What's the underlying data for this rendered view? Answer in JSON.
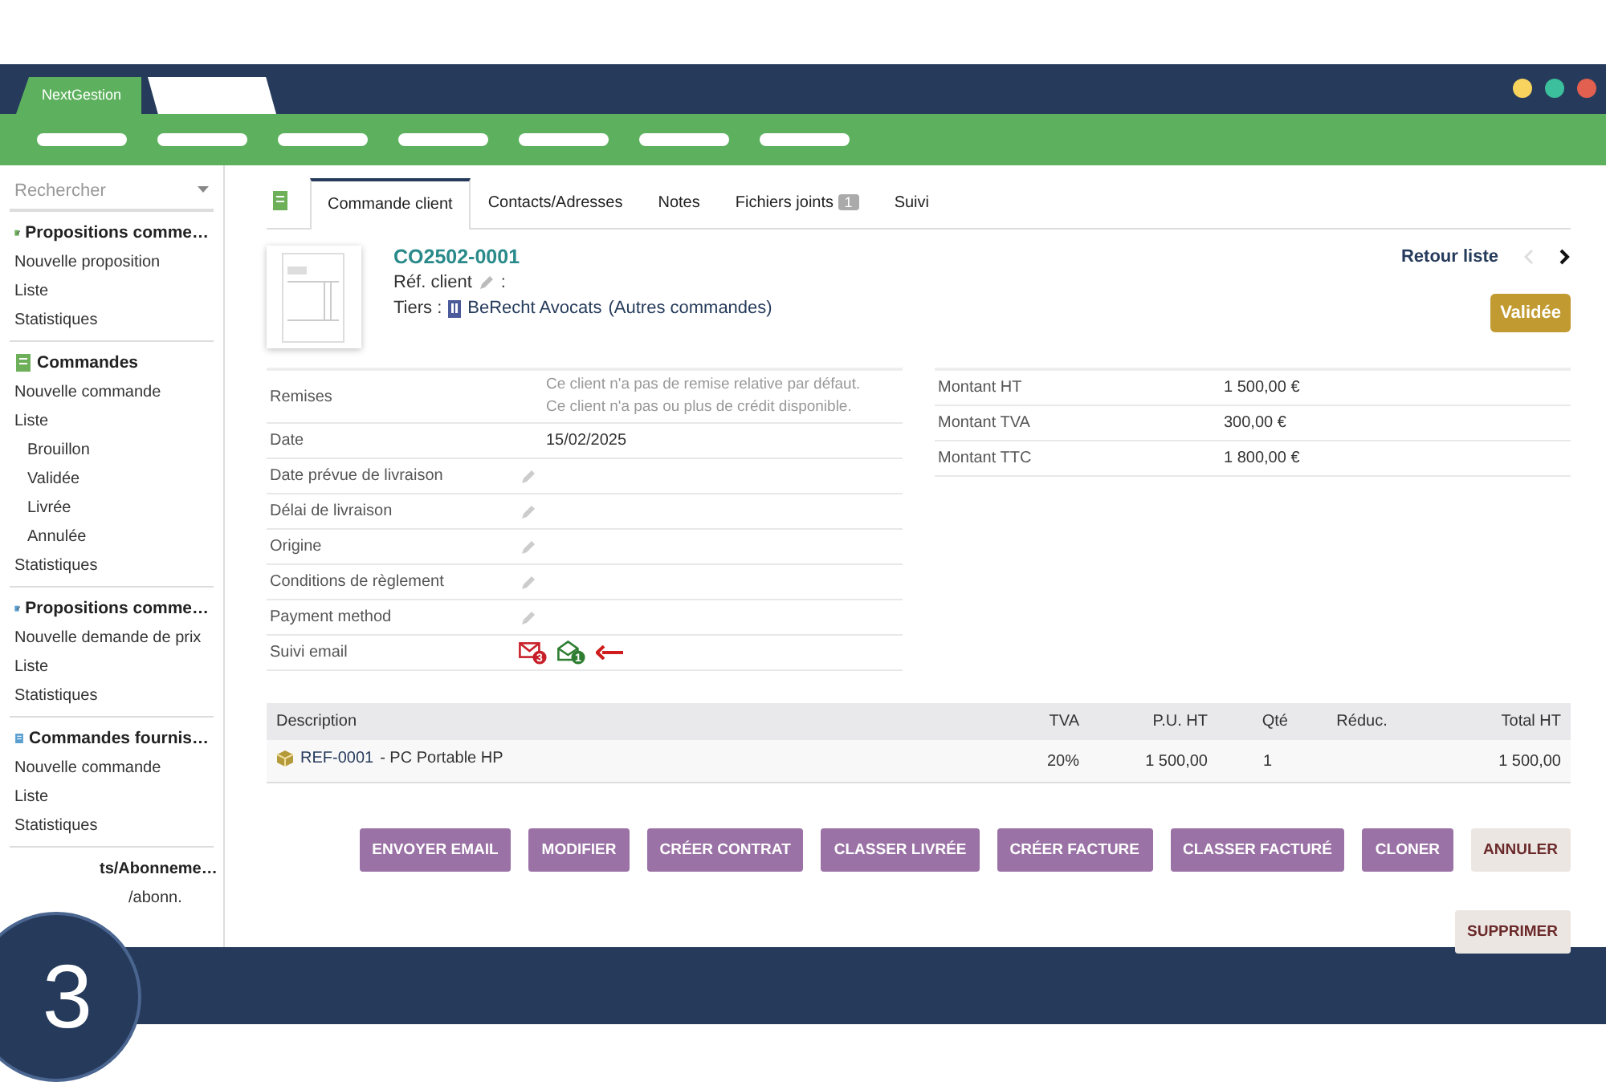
{
  "app_tabs": [
    {
      "label": "NextGestion",
      "selected": true
    },
    {
      "selected": false
    }
  ],
  "sidebar": {
    "search": {
      "placeholder": "Rechercher"
    },
    "groups": [
      {
        "title": "Propositions comme…",
        "kind": "proposal",
        "items": [
          {
            "label": "Nouvelle proposition"
          },
          {
            "label": "Liste"
          },
          {
            "label": "Statistiques"
          }
        ]
      },
      {
        "title": "Commandes",
        "kind": "order",
        "items": [
          {
            "label": "Nouvelle commande"
          },
          {
            "label": "Liste",
            "children": [
              {
                "label": "Brouillon"
              },
              {
                "label": "Validée"
              },
              {
                "label": "Livrée"
              },
              {
                "label": "Annulée"
              }
            ]
          },
          {
            "label": "Statistiques"
          }
        ]
      },
      {
        "title": "Propositions comme…",
        "kind": "supplier-proposal",
        "items": [
          {
            "label": "Nouvelle demande de prix"
          },
          {
            "label": "Liste"
          },
          {
            "label": "Statistiques"
          }
        ]
      },
      {
        "title": "Commandes fournis…",
        "kind": "supplier-order",
        "items": [
          {
            "label": "Nouvelle commande"
          },
          {
            "label": "Liste"
          },
          {
            "label": "Statistiques"
          }
        ]
      },
      {
        "title": "ts/Abonneme…",
        "kind": "none",
        "items": [
          {
            "label": "/abonn."
          }
        ]
      }
    ]
  },
  "tabs": [
    {
      "label": "Commande client",
      "selected": true
    },
    {
      "label": "Contacts/Adresses",
      "selected": false
    },
    {
      "label": "Notes",
      "selected": false
    },
    {
      "label": "Fichiers joints",
      "badge": "1",
      "selected": false
    },
    {
      "label": "Suivi",
      "selected": false
    }
  ],
  "header": {
    "ref": "CO2502-0001",
    "ref_client_label": "Réf. client",
    "ref_client_sep": ":",
    "tiers_label": "Tiers :",
    "tiers_name": "BeRecht Avocats",
    "tiers_link": "(Autres commandes)",
    "back": "Retour liste",
    "status": "Validée"
  },
  "fields": [
    {
      "label": "Remises",
      "kind": "notes",
      "lines": [
        "Ce client n'a pas de remise relative par défaut.",
        "Ce client n'a pas ou plus de crédit disponible."
      ]
    },
    {
      "label": "Date",
      "kind": "value",
      "value": "15/02/2025"
    },
    {
      "label": "Date prévue de livraison",
      "kind": "edit"
    },
    {
      "label": "Délai de livraison",
      "kind": "edit"
    },
    {
      "label": "Origine",
      "kind": "edit"
    },
    {
      "label": "Conditions de règlement",
      "kind": "edit"
    },
    {
      "label": "Payment method",
      "kind": "edit"
    },
    {
      "label": "Suivi email",
      "kind": "email",
      "sent": "3",
      "opened": "1"
    }
  ],
  "totals": [
    {
      "label": "Montant HT",
      "value": "1 500,00 €"
    },
    {
      "label": "Montant TVA",
      "value": "300,00 €"
    },
    {
      "label": "Montant TTC",
      "value": "1 800,00 €"
    }
  ],
  "lines_table": {
    "columns": [
      "Description",
      "TVA",
      "P.U. HT",
      "Qté",
      "Réduc.",
      "Total HT"
    ],
    "rows": [
      {
        "ref": "REF-0001",
        "label": "- PC Portable HP",
        "tva": "20%",
        "pu": "1 500,00",
        "qty": "1",
        "total": "1 500,00"
      }
    ]
  },
  "buttons": [
    {
      "label": "ENVOYER EMAIL",
      "kind": "action"
    },
    {
      "label": "MODIFIER",
      "kind": "action"
    },
    {
      "label": "CRÉER CONTRAT",
      "kind": "action"
    },
    {
      "label": "CLASSER LIVRÉE",
      "kind": "action"
    },
    {
      "label": "CRÉER FACTURE",
      "kind": "action"
    },
    {
      "label": "CLASSER FACTURÉ",
      "kind": "action"
    },
    {
      "label": "CLONER",
      "kind": "action"
    },
    {
      "label": "ANNULER",
      "kind": "danger"
    },
    {
      "label": "SUPPRIMER",
      "kind": "danger"
    }
  ],
  "step": "3"
}
